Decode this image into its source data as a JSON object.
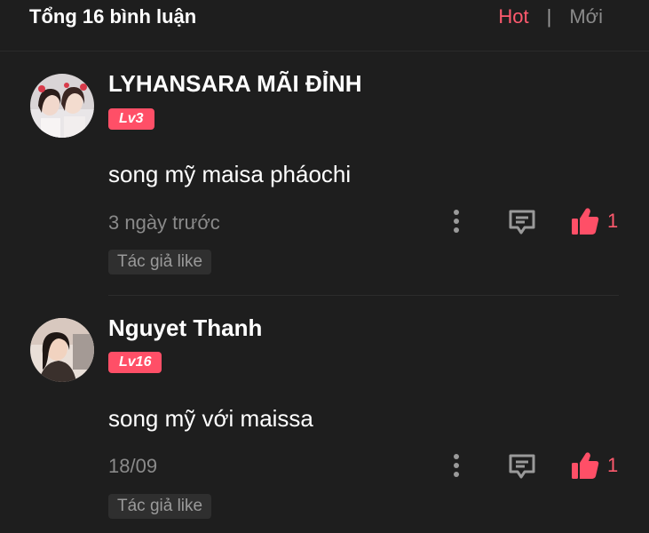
{
  "header": {
    "title": "Tổng 16 bình luận",
    "sort_hot": "Hot",
    "sort_separator": "|",
    "sort_new": "Mới"
  },
  "colors": {
    "accent": "#ff5a6e",
    "badge": "#ff4f67",
    "background": "#1e1e1e"
  },
  "comments": [
    {
      "username": "LYHANSARA MÃI ĐỈNH",
      "level": "Lv3",
      "content": "song mỹ maisa pháochi",
      "time": "3 ngày trước",
      "likes": "1",
      "author_like": "Tác giả like",
      "icons": [
        "more-vertical-icon",
        "reply-icon",
        "thumbs-up-icon"
      ]
    },
    {
      "username": "Nguyet Thanh",
      "level": "Lv16",
      "content": "song mỹ với maissa",
      "time": "18/09",
      "likes": "1",
      "author_like": "Tác giả like",
      "icons": [
        "more-vertical-icon",
        "reply-icon",
        "thumbs-up-icon"
      ]
    }
  ]
}
